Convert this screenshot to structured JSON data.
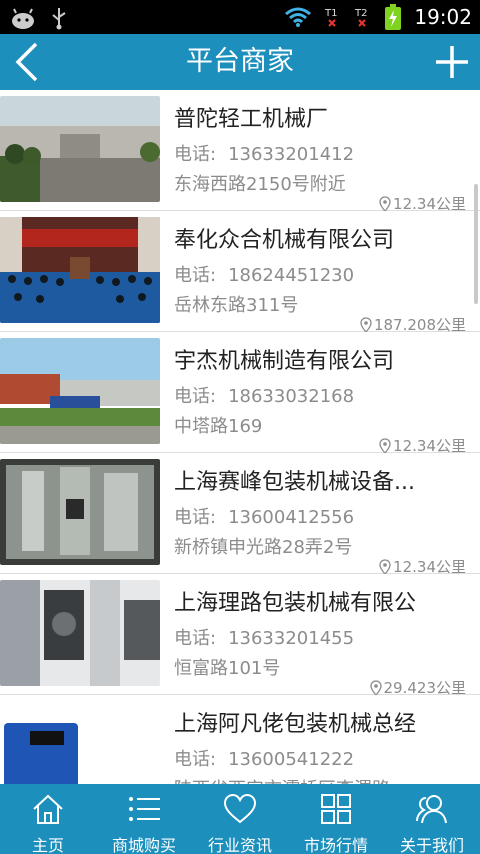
{
  "status": {
    "time": "19:02"
  },
  "header": {
    "title": "平台商家"
  },
  "merchants": [
    {
      "name": "普陀轻工机械厂",
      "phone_label": "电话:",
      "phone": "13633201412",
      "address": "东海西路2150号附近",
      "distance": "12.34公里"
    },
    {
      "name": "奉化众合机械有限公司",
      "phone_label": "电话:",
      "phone": "18624451230",
      "address": "岳林东路311号",
      "distance": "187.208公里"
    },
    {
      "name": "宇杰机械制造有限公司",
      "phone_label": "电话:",
      "phone": "18633032168",
      "address": "中塔路169",
      "distance": "12.34公里"
    },
    {
      "name": "上海赛峰包装机械设备...",
      "phone_label": "电话:",
      "phone": "13600412556",
      "address": "新桥镇申光路28弄2号",
      "distance": "12.34公里"
    },
    {
      "name": "上海理路包装机械有限公",
      "phone_label": "电话:",
      "phone": "13633201455",
      "address": "恒富路101号",
      "distance": "29.423公里"
    },
    {
      "name": "上海阿凡佬包装机械总经",
      "phone_label": "电话:",
      "phone": "13600541222",
      "address": "陕西省西安市灞桥区李渭路",
      "distance": ""
    }
  ],
  "tabs": [
    {
      "label": "主页",
      "icon": "home-icon"
    },
    {
      "label": "商城购买",
      "icon": "list-icon"
    },
    {
      "label": "行业资讯",
      "icon": "heart-icon"
    },
    {
      "label": "市场行情",
      "icon": "grid-icon"
    },
    {
      "label": "关于我们",
      "icon": "people-icon"
    }
  ],
  "colors": {
    "accent": "#1c8fbd",
    "text_secondary": "#8c8c8c"
  }
}
